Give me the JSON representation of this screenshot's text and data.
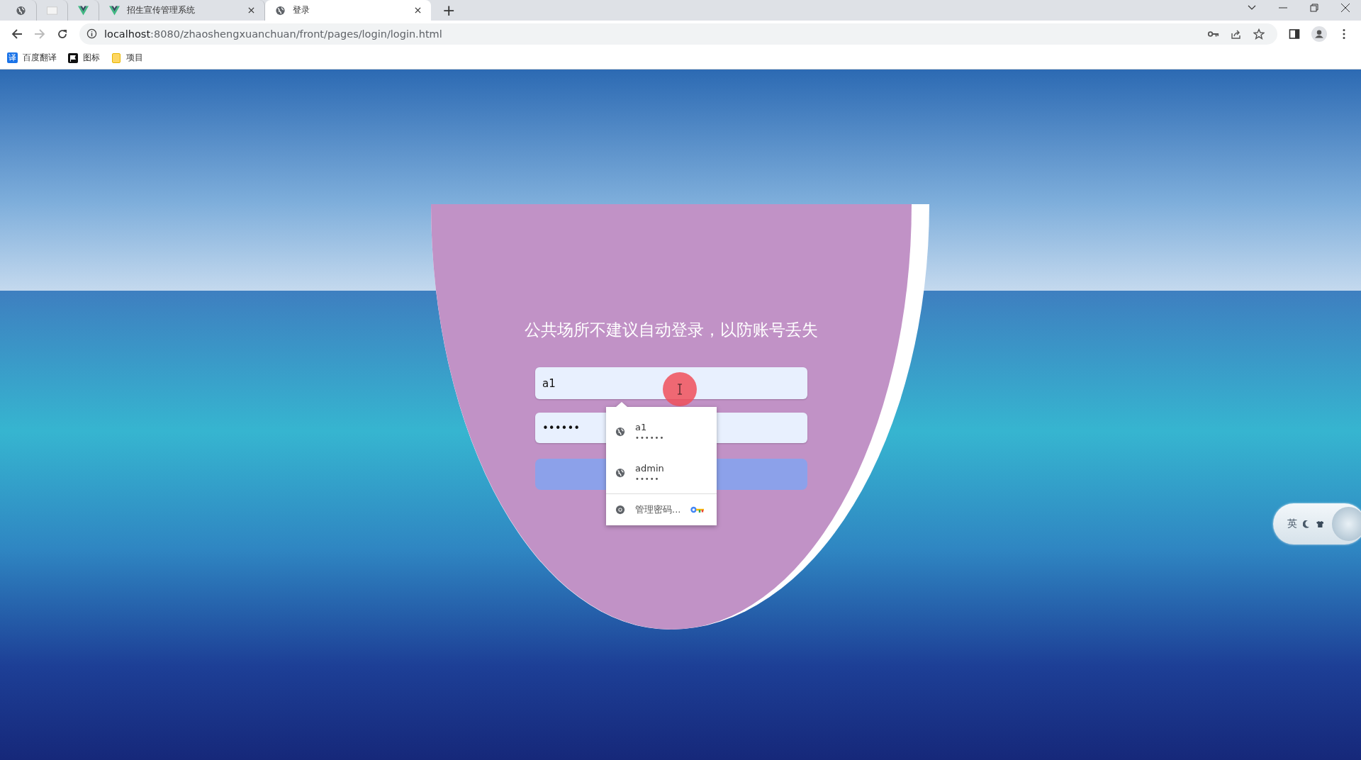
{
  "browser": {
    "tabs": [
      {
        "kind": "globe",
        "selected": false
      },
      {
        "kind": "blank",
        "selected": false
      },
      {
        "kind": "vue",
        "selected": false
      },
      {
        "kind": "vue",
        "title": "招生宣传管理系统",
        "selected": false
      },
      {
        "kind": "globe",
        "title": "登录",
        "selected": true
      }
    ],
    "new_tab": "+",
    "url": "localhost:8080/zhaoshengxuanchuan/front/pages/login/login.html",
    "bookmarks": [
      {
        "kind": "translate",
        "badge": "译",
        "label": "百度翻译"
      },
      {
        "kind": "flag",
        "label": "图标"
      },
      {
        "kind": "folder",
        "label": "项目"
      }
    ]
  },
  "login": {
    "title": "公共场所不建议自动登录，以防账号丢失",
    "username": "a1",
    "password": "••••••"
  },
  "autofill": {
    "items": [
      {
        "username": "a1",
        "password": "••••••"
      },
      {
        "username": "admin",
        "password": "•••••"
      }
    ],
    "manage": "管理密码..."
  },
  "ime": {
    "label": "英"
  }
}
